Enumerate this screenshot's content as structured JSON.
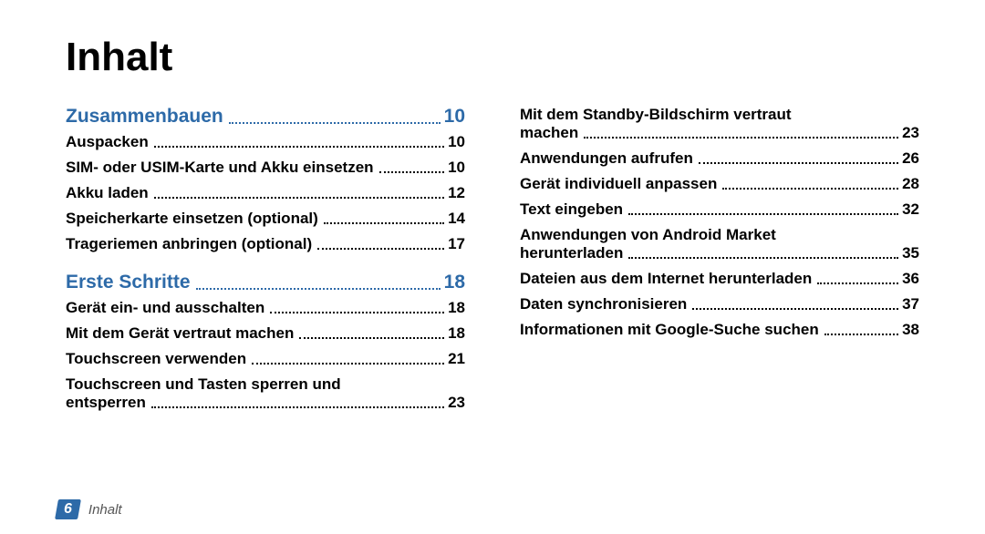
{
  "title": "Inhalt",
  "footer": {
    "page": "6",
    "label": "Inhalt"
  },
  "left": {
    "sections": [
      {
        "head": {
          "label": "Zusammenbauen",
          "page": "10"
        },
        "items": [
          {
            "label": "Auspacken",
            "page": "10"
          },
          {
            "label": "SIM- oder USIM-Karte und Akku einsetzen",
            "page": "10"
          },
          {
            "label": "Akku laden",
            "page": "12"
          },
          {
            "label": "Speicherkarte einsetzen (optional)",
            "page": "14"
          },
          {
            "label": "Trageriemen anbringen (optional)",
            "page": "17"
          }
        ]
      },
      {
        "head": {
          "label": "Erste Schritte",
          "page": "18"
        },
        "items": [
          {
            "label": "Gerät ein- und ausschalten",
            "page": "18"
          },
          {
            "label": "Mit dem Gerät vertraut machen",
            "page": "18"
          },
          {
            "label": "Touchscreen verwenden",
            "page": "21"
          },
          {
            "line1": "Touchscreen und Tasten sperren und",
            "line2": "entsperren",
            "page": "23"
          }
        ]
      }
    ]
  },
  "right": {
    "items": [
      {
        "line1": "Mit dem Standby-Bildschirm vertraut",
        "line2": "machen",
        "page": "23"
      },
      {
        "label": "Anwendungen aufrufen",
        "page": "26"
      },
      {
        "label": "Gerät individuell anpassen",
        "page": "28"
      },
      {
        "label": "Text eingeben",
        "page": "32"
      },
      {
        "line1": "Anwendungen von Android Market",
        "line2": "herunterladen",
        "page": "35"
      },
      {
        "label": "Dateien aus dem Internet herunterladen",
        "page": "36"
      },
      {
        "label": "Daten synchronisieren",
        "page": "37"
      },
      {
        "label": "Informationen mit Google-Suche suchen",
        "page": "38"
      }
    ]
  }
}
